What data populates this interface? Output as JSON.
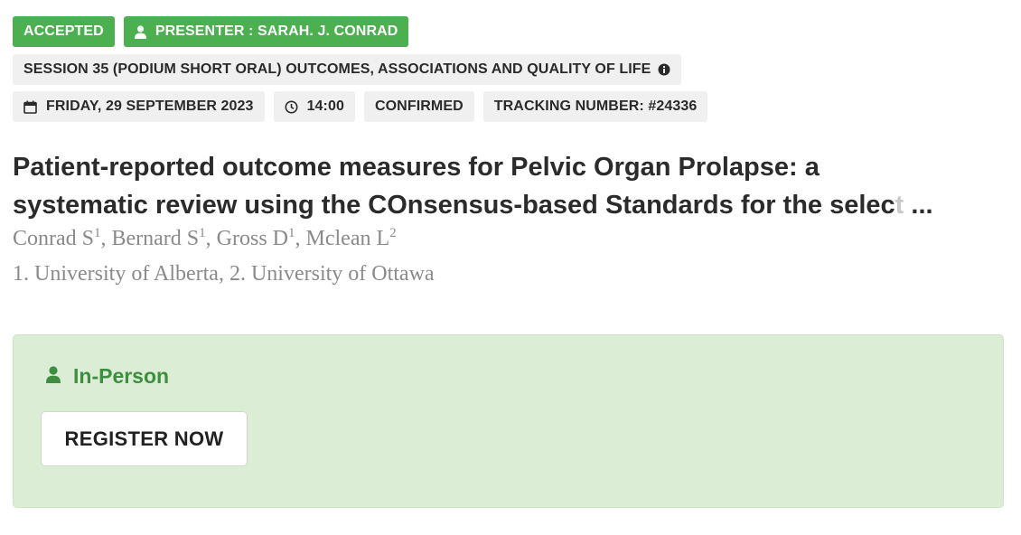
{
  "badges": {
    "accepted": "ACCEPTED",
    "presenter": "PRESENTER : SARAH. J. CONRAD"
  },
  "session": {
    "label": "SESSION 35 (PODIUM SHORT ORAL) OUTCOMES, ASSOCIATIONS AND QUALITY OF LIFE"
  },
  "meta": {
    "date": "FRIDAY, 29 SEPTEMBER 2023",
    "time": "14:00",
    "status": "CONFIRMED",
    "tracking": "TRACKING NUMBER: #24336"
  },
  "abstract": {
    "title_line1": "Patient-reported outcome measures for Pelvic Organ Prolapse: a",
    "title_line2": "systematic review using the COnsensus-based Standards for the selec",
    "title_line2_fade": "t",
    "title_ellipsis": " ...",
    "authors": [
      {
        "name": "Conrad S",
        "sup": "1",
        "sep": ", "
      },
      {
        "name": "Bernard S",
        "sup": "1",
        "sep": ", "
      },
      {
        "name": "Gross D",
        "sup": "1",
        "sep": ", "
      },
      {
        "name": "Mclean L",
        "sup": "2",
        "sep": ""
      }
    ],
    "affiliations": "1. University of Alberta, 2. University of Ottawa"
  },
  "registration": {
    "mode": "In-Person",
    "button_label": "REGISTER NOW"
  },
  "icons": {
    "presenter": "user-icon",
    "info": "info-circle-icon",
    "date": "calendar-icon",
    "time": "clock-icon",
    "mode": "user-icon"
  },
  "colors": {
    "accent_green": "#4caf50",
    "panel_bg": "#dcedd6",
    "mode_text": "#3e8e41",
    "chip_bg": "#f0f0f0"
  }
}
